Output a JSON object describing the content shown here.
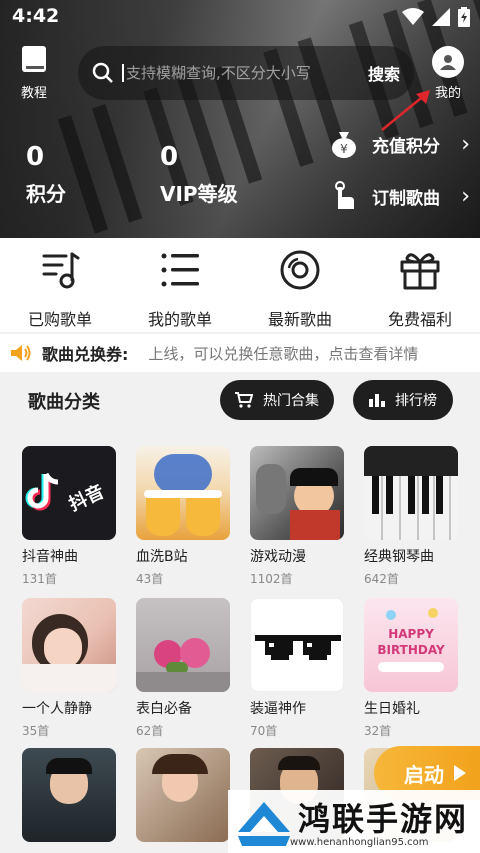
{
  "status_bar": {
    "time": "4:42"
  },
  "header": {
    "guide_label": "教程",
    "search_placeholder": "支持模糊查询,不区分大小写",
    "search_button": "搜索",
    "mine_label": "我的"
  },
  "stats": [
    {
      "value": "0",
      "label": "积分"
    },
    {
      "value": "0",
      "label": "VIP等级"
    }
  ],
  "actions": [
    {
      "label": "充值积分",
      "icon": "money-bag-icon"
    },
    {
      "label": "订制歌曲",
      "icon": "tap-hand-icon"
    }
  ],
  "quick_nav": [
    {
      "label": "已购歌单",
      "icon": "music-list-icon"
    },
    {
      "label": "我的歌单",
      "icon": "list-icon"
    },
    {
      "label": "最新歌曲",
      "icon": "disc-icon"
    },
    {
      "label": "免费福利",
      "icon": "gift-icon"
    }
  ],
  "notice": {
    "title": "歌曲兑换券:",
    "message": "上线，可以兑换任意歌曲，点击查看详情"
  },
  "categories_section": {
    "title": "歌曲分类",
    "hot_button": "热门合集",
    "rank_button": "排行榜"
  },
  "categories": [
    {
      "name": "抖音神曲",
      "count": "131首"
    },
    {
      "name": "血洗B站",
      "count": "43首"
    },
    {
      "name": "游戏动漫",
      "count": "1102首"
    },
    {
      "name": "经典钢琴曲",
      "count": "642首"
    },
    {
      "name": "一个人静静",
      "count": "35首"
    },
    {
      "name": "表白必备",
      "count": "62首"
    },
    {
      "name": "装逼神作",
      "count": "70首"
    },
    {
      "name": "生日婚礼",
      "count": "32首"
    }
  ],
  "thumb_text": {
    "douyin_logo": "抖音",
    "birthday": "HAPPY BIRTHDAY"
  },
  "launch_button": "启动",
  "watermark": {
    "title": "鸿联手游网",
    "url": "www.henanhonglian95.com"
  }
}
